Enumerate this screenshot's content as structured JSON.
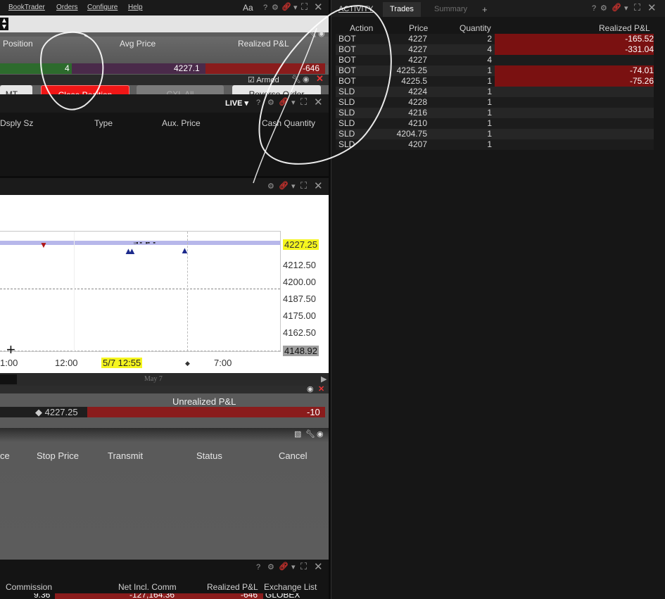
{
  "menu": {
    "items": [
      "BookTrader",
      "Orders",
      "Configure",
      "Help"
    ],
    "font_label": "Aa",
    "help_label": "?"
  },
  "position_panel": {
    "headers": {
      "position": "Position",
      "avg_price": "Avg Price",
      "realized_pnl": "Realized P&L"
    },
    "values": {
      "position": "4",
      "avg_price": "4227.1",
      "realized_pnl": "-646"
    },
    "armed_label": "Armed",
    "buttons": {
      "mkt": "MT ...",
      "close_position": "Close Position",
      "cxl_all": "CXL All",
      "reverse_order": "Reverse Order"
    }
  },
  "orders_panel": {
    "live_label": "LIVE",
    "columns": [
      "Dsply Sz",
      "Type",
      "Aux. Price",
      "Cash Quantity"
    ]
  },
  "chart": {
    "price_labels": [
      "4227.25",
      "4212.50",
      "4200.00",
      "4187.50",
      "4175.00",
      "4162.50",
      "4148.92"
    ],
    "x_labels": [
      "1:00",
      "12:00",
      "5/7 12:55",
      "7:00"
    ],
    "timeline_label": "May 7",
    "current_price": "4227.25"
  },
  "unrealized_panel": {
    "header": "Unrealized P&L",
    "price": "4227.25",
    "value": "-10"
  },
  "entry_panel": {
    "columns": [
      "ce",
      "Stop Price",
      "Transmit",
      "Status",
      "Cancel"
    ]
  },
  "bottom_panel": {
    "columns": [
      "Commission",
      "Net Incl. Comm",
      "Realized P&L",
      "Exchange List"
    ],
    "values": [
      "9.36",
      "-127,164.36",
      "-646",
      "GLOBEX"
    ]
  },
  "activity": {
    "tabs": [
      "ACTIVITY",
      "Trades",
      "Summary",
      "+"
    ],
    "columns": [
      "Action",
      "Price",
      "Quantity",
      "Realized P&L"
    ],
    "rows": [
      {
        "action": "BOT",
        "price": "4227",
        "qty": "2",
        "pnl": "-165.52"
      },
      {
        "action": "BOT",
        "price": "4227",
        "qty": "4",
        "pnl": "-331.04"
      },
      {
        "action": "BOT",
        "price": "4227",
        "qty": "4",
        "pnl": ""
      },
      {
        "action": "BOT",
        "price": "4225.25",
        "qty": "1",
        "pnl": "-74.01"
      },
      {
        "action": "BOT",
        "price": "4225.5",
        "qty": "1",
        "pnl": "-75.26"
      },
      {
        "action": "SLD",
        "price": "4224",
        "qty": "1",
        "pnl": ""
      },
      {
        "action": "SLD",
        "price": "4228",
        "qty": "1",
        "pnl": ""
      },
      {
        "action": "SLD",
        "price": "4216",
        "qty": "1",
        "pnl": ""
      },
      {
        "action": "SLD",
        "price": "4210",
        "qty": "1",
        "pnl": ""
      },
      {
        "action": "SLD",
        "price": "4204.75",
        "qty": "1",
        "pnl": ""
      },
      {
        "action": "SLD",
        "price": "4207",
        "qty": "1",
        "pnl": ""
      }
    ]
  },
  "colors": {
    "loss": "#7a1111",
    "accent_red": "#e8201a",
    "highlight_yellow": "#f5f51e",
    "position_green": "#2a5a2a"
  }
}
